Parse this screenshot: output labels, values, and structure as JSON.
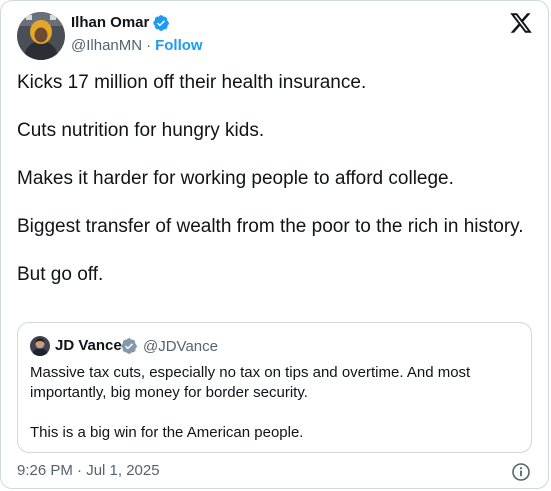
{
  "author": {
    "name": "Ilhan Omar",
    "handle": "@IlhanMN",
    "separator": "·",
    "follow_label": "Follow",
    "verified": true
  },
  "tweet": {
    "paragraphs": [
      "Kicks 17 million off their health insurance.",
      "Cuts nutrition for hungry kids.",
      "Makes it harder for working people to afford college.",
      "Biggest transfer of wealth from the poor to the rich in history.",
      "But go off."
    ]
  },
  "quote": {
    "name": "JD Vance",
    "handle": "@JDVance",
    "verified": true,
    "paragraphs": [
      "Massive tax cuts, especially no tax on tips and overtime. And most importantly, big money for border security.",
      "This is a big win for the American people."
    ]
  },
  "footer": {
    "timestamp": "9:26 PM · Jul 1, 2025"
  },
  "icons": {
    "brand": "x-logo-icon",
    "verified": "verified-badge-icon",
    "info": "info-icon"
  },
  "colors": {
    "text": "#0f1419",
    "secondary": "#536471",
    "link": "#1d9bf0",
    "border": "#cfd9de",
    "verified_badge": "#1d9bf0"
  }
}
